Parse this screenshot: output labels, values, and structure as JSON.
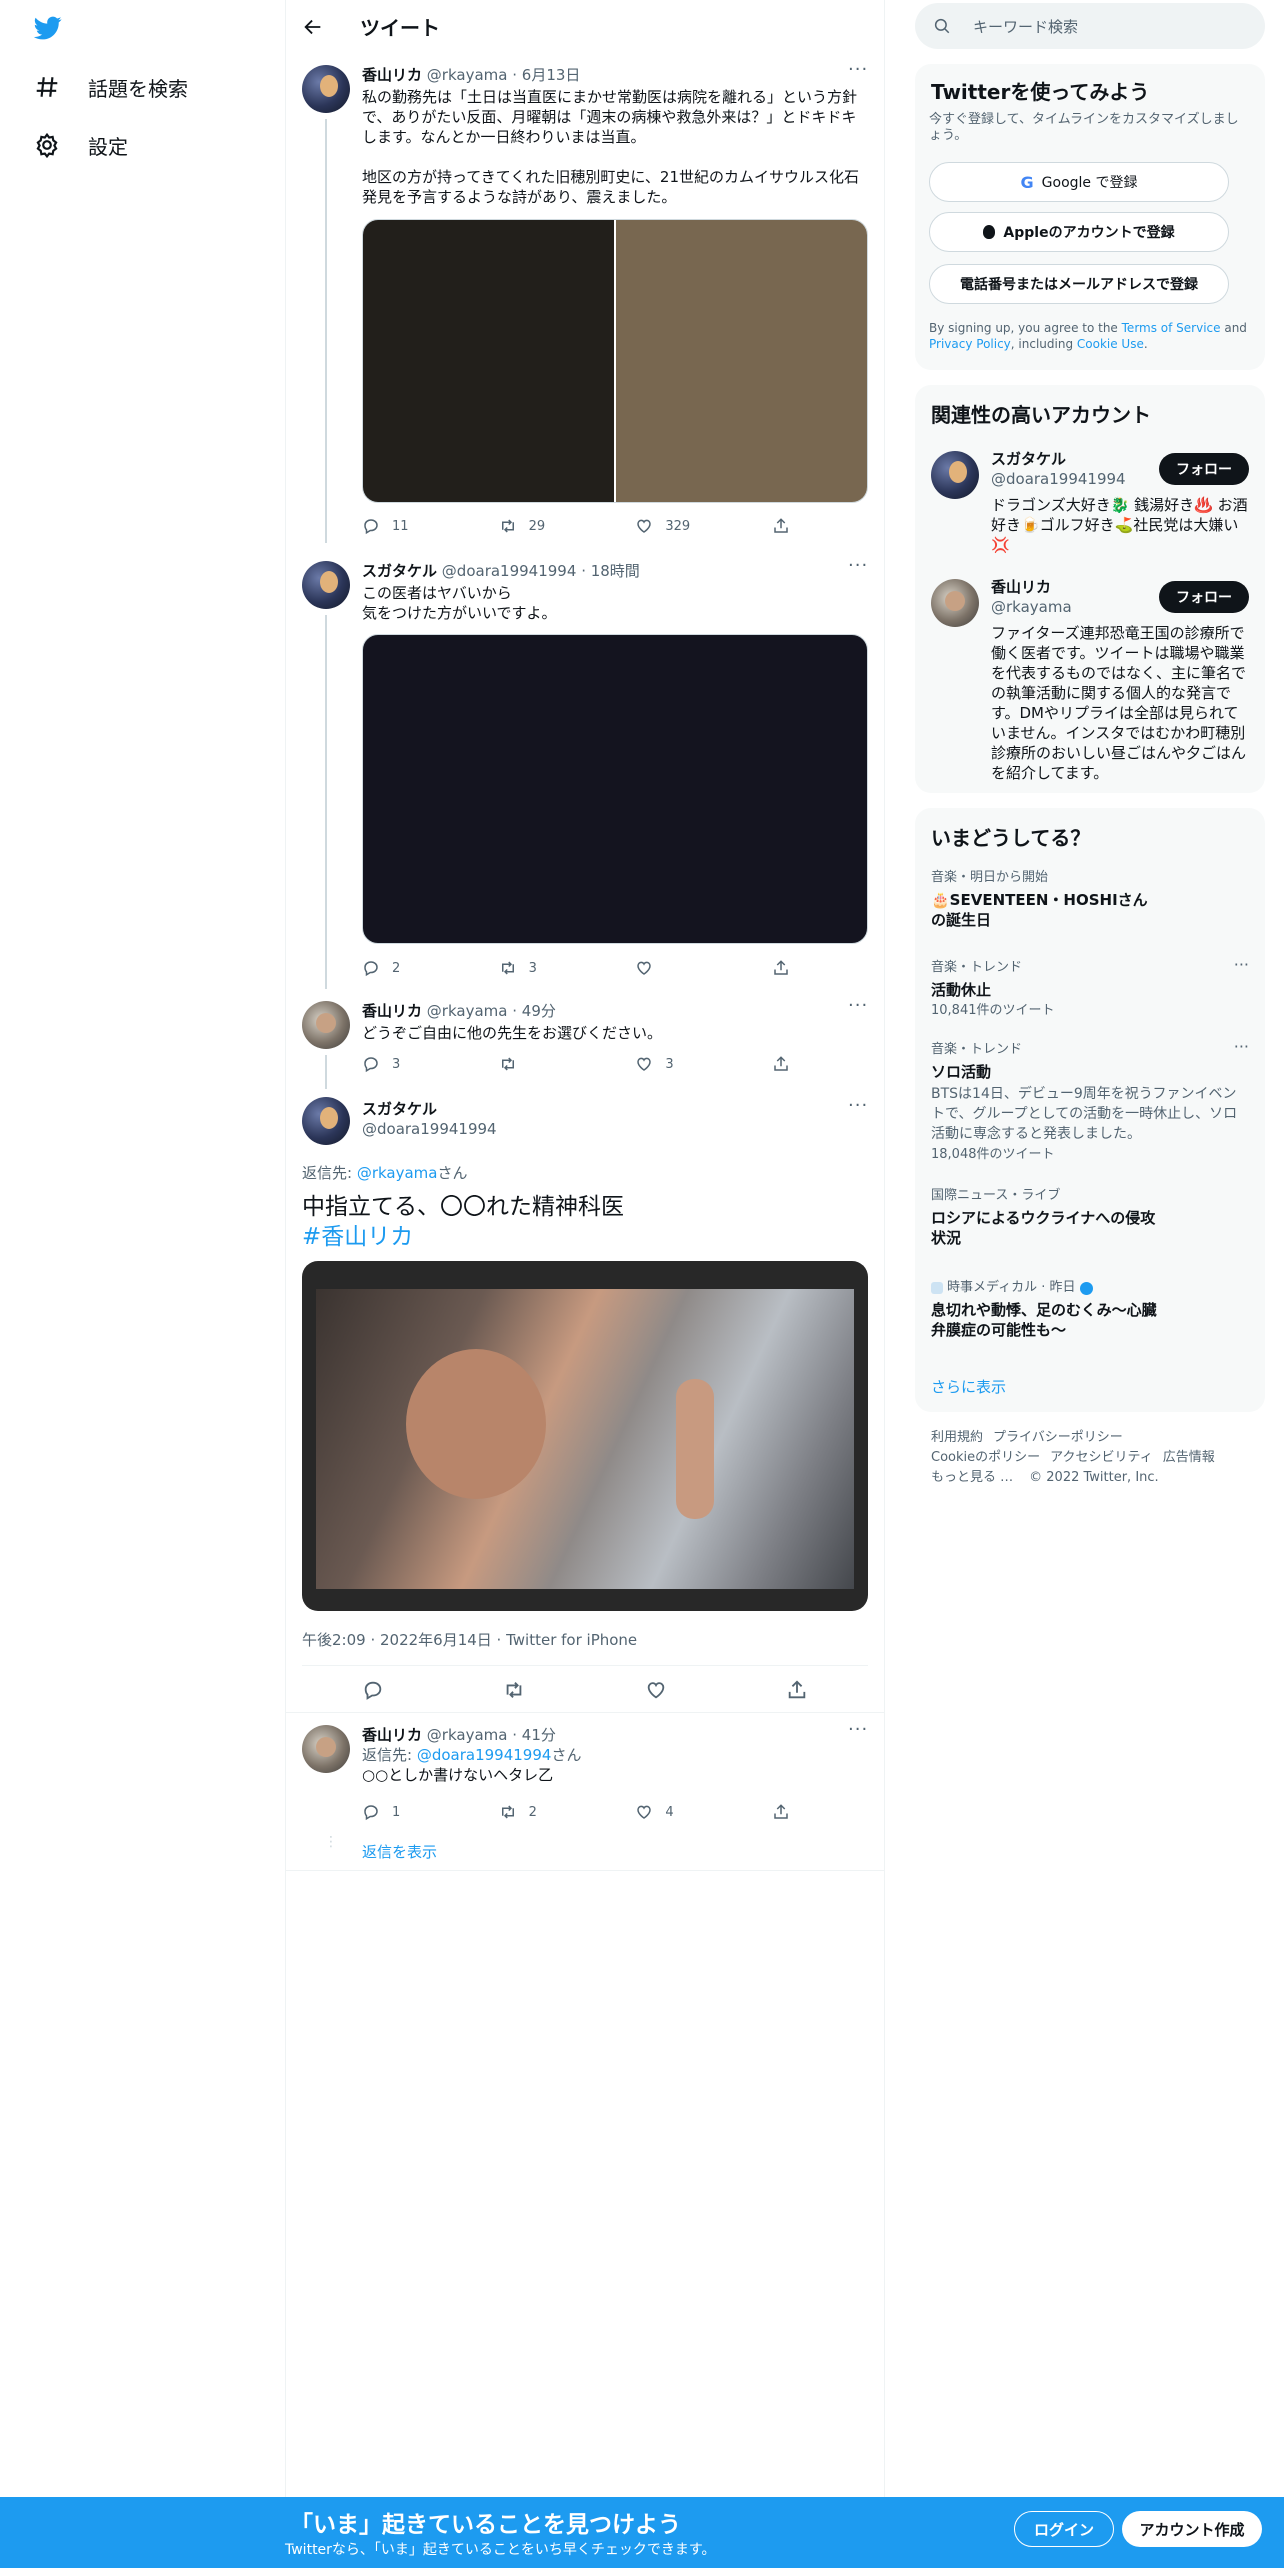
{
  "nav": {
    "items": [
      {
        "label": "話題を検索",
        "icon": "hashtag-icon"
      },
      {
        "label": "設定",
        "icon": "gear-icon"
      }
    ]
  },
  "header": {
    "title": "ツイート"
  },
  "tweets": [
    {
      "name": "香山リカ",
      "handle": "@rkayama",
      "time": "· 6月13日",
      "text": "私の勤務先は「土日は当直医にまかせ常勤医は病院を離れる」という方針で、ありがたい反面、月曜朝は「週末の病棟や救急外来は？」とドキドキします。なんとか一日終わりいまは当直。\n\n地区の方が持ってきてくれた旧穂別町史に、21世紀のカムイサウルス化石発見を予言するような詩があり、震えました。",
      "replies": "11",
      "retweets": "29",
      "likes": "329"
    },
    {
      "name": "スガタケル",
      "handle": "@doara19941994",
      "time": "· 18時間",
      "text": "この医者はヤバいから\n気をつけた方がいいですよ。",
      "replies": "2",
      "retweets": "3",
      "likes": ""
    },
    {
      "name": "香山リカ",
      "handle": "@rkayama",
      "time": "· 49分",
      "text": "どうぞご自由に他の先生をお選びください。",
      "replies": "3",
      "retweets": "",
      "likes": "3"
    }
  ],
  "main_tweet": {
    "name": "スガタケル",
    "handle": "@doara19941994",
    "reply_prefix": "返信先: ",
    "reply_to": "@rkayama",
    "reply_suffix": "さん",
    "text": "中指立てる、〇〇れた精神科医",
    "hashtag": "#香山リカ",
    "timestamp": "午後2:09 · 2022年6月14日 · Twitter for iPhone"
  },
  "reply_tweet": {
    "name": "香山リカ",
    "handle": "@rkayama",
    "time": "· 41分",
    "reply_prefix": "返信先: ",
    "reply_to": "@doara19941994",
    "reply_suffix": "さん",
    "text": "○○としか書けないヘタレ乙",
    "replies": "1",
    "retweets": "2",
    "likes": "4",
    "show_replies": "返信を表示"
  },
  "search": {
    "placeholder": "キーワード検索"
  },
  "signup_card": {
    "title": "Twitterを使ってみよう",
    "subtitle": "今すぐ登録して、タイムラインをカスタマイズしましょう。",
    "google": "Google で登録",
    "apple": "Appleのアカウントで登録",
    "phone": "電話番号またはメールアドレスで登録",
    "terms_prefix": "By signing up, you agree to the ",
    "terms": "Terms of Service",
    "and": " and ",
    "privacy": "Privacy Policy",
    "including": ", including ",
    "cookie": "Cookie Use",
    "period": "."
  },
  "related": {
    "title": "関連性の高いアカウント",
    "accounts": [
      {
        "name": "スガタケル",
        "handle": "@doara19941994",
        "follow": "フォロー",
        "bio": "ドラゴンズ大好き🐉 銭湯好き♨️ お酒好き🍺ゴルフ好き⛳️社民党は大嫌い💢"
      },
      {
        "name": "香山リカ",
        "handle": "@rkayama",
        "follow": "フォロー",
        "bio": "ファイターズ連邦恐竜王国の診療所で働く医者です。ツイートは職場や職業を代表するものではなく、主に筆名での執筆活動に関する個人的な発言です。DMやリプライは全部は見られていません。インスタではむかわ町穂別診療所のおいしい昼ごはんや夕ごはんを紹介してます。"
      }
    ]
  },
  "trends": {
    "title": "いまどうしてる？",
    "items": [
      {
        "category": "音楽・明日から開始",
        "title": "🎂SEVENTEEN・HOSHIさんの誕生日",
        "desc": "",
        "count": ""
      },
      {
        "category": "音楽・トレンド",
        "title": "活動休止",
        "desc": "",
        "count": "10,841件のツイート"
      },
      {
        "category": "音楽・トレンド",
        "title": "ソロ活動",
        "desc": "BTSは14日、デビュー9周年を祝うファンイベントで、グループとしての活動を一時休止し、ソロ活動に専念すると発表しました。",
        "count": "18,048件のツイート"
      },
      {
        "category": "国際ニュース・ライブ",
        "title": "ロシアによるウクライナへの侵攻状況",
        "desc": "",
        "count": ""
      },
      {
        "category": "時事メディカル · 昨日",
        "title": "息切れや動悸、足のむくみ～心臓弁膜症の可能性も～",
        "desc": "",
        "count": ""
      }
    ],
    "show_more": "さらに表示"
  },
  "footer": {
    "links": [
      "利用規約",
      "プライバシーポリシー",
      "Cookieのポリシー",
      "アクセシビリティ",
      "広告情報",
      "もっと見る …"
    ],
    "copyright": "© 2022 Twitter, Inc."
  },
  "banner": {
    "title": "「いま」起きていることを見つけよう",
    "subtitle": "Twitterなら、「いま」起きていることをいち早くチェックできます。",
    "login": "ログイン",
    "signup": "アカウント作成"
  },
  "colors": {
    "accent": "#1d9bf0",
    "text": "#0f1419",
    "muted": "#536471",
    "banner": "#1d9bf0"
  }
}
